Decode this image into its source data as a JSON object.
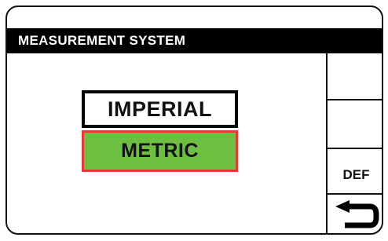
{
  "header": {
    "title": "MEASUREMENT SYSTEM"
  },
  "options": [
    {
      "label": "IMPERIAL",
      "selected": false
    },
    {
      "label": "METRIC",
      "selected": true
    }
  ],
  "side_panel": {
    "def_label": "DEF",
    "back_icon": "return-arrow-icon"
  },
  "colors": {
    "selected_fill": "#6cbf40",
    "selected_border": "#e53935",
    "title_bar": "#000000"
  }
}
